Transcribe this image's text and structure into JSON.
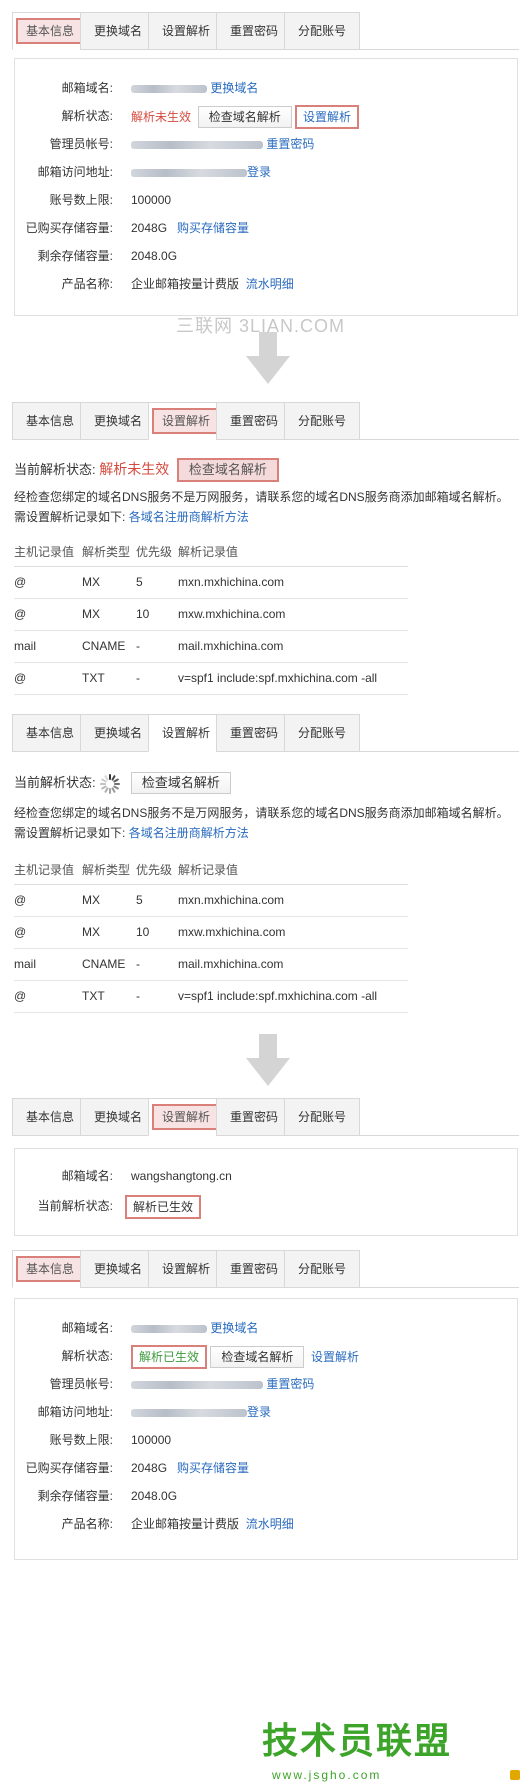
{
  "tabs": [
    "基本信息",
    "更换域名",
    "设置解析",
    "重置密码",
    "分配账号"
  ],
  "panel1": {
    "rows": [
      {
        "label": "邮箱域名:",
        "link": "更换域名"
      },
      {
        "label": "解析状态:",
        "status": "解析未生效",
        "button": "检查域名解析",
        "link": "设置解析"
      },
      {
        "label": "管理员帐号:",
        "link": "重置密码"
      },
      {
        "label": "邮箱访问地址:",
        "link": "登录"
      },
      {
        "label": "账号数上限:",
        "value": "100000"
      },
      {
        "label": "已购买存储容量:",
        "value": "2048G",
        "link": "购买存储容量"
      },
      {
        "label": "剩余存储容量:",
        "value": "2048.0G"
      },
      {
        "label": "产品名称:",
        "value": "企业邮箱按量计费版",
        "link": "流水明细"
      }
    ]
  },
  "watermark": "三联网 3LIAN.COM",
  "dns_section": {
    "status_label": "当前解析状态:",
    "status_value": "解析未生效",
    "check_button": "检查域名解析",
    "notice": "经检查您绑定的域名DNS服务不是万网服务，请联系您的域名DNS服务商添加邮箱域名解析。",
    "need_text": "需设置解析记录如下:",
    "method_link": "各域名注册商解析方法",
    "headers": [
      "主机记录值",
      "解析类型",
      "优先级",
      "解析记录值"
    ],
    "records": [
      [
        "@",
        "MX",
        "5",
        "mxn.mxhichina.com"
      ],
      [
        "@",
        "MX",
        "10",
        "mxw.mxhichina.com"
      ],
      [
        "mail",
        "CNAME",
        "-",
        "mail.mxhichina.com"
      ],
      [
        "@",
        "TXT",
        "-",
        "v=spf1 include:spf.mxhichina.com -all"
      ]
    ]
  },
  "panel4": {
    "domain_label": "邮箱域名:",
    "domain_value": "wangshangtong.cn",
    "status_label": "当前解析状态:",
    "status_value": "解析已生效"
  },
  "panel5": {
    "rows": [
      {
        "label": "邮箱域名:",
        "link": "更换域名"
      },
      {
        "label": "解析状态:",
        "status": "解析已生效",
        "button": "检查域名解析",
        "link": "设置解析"
      },
      {
        "label": "管理员帐号:",
        "link": "重置密码"
      },
      {
        "label": "邮箱访问地址:",
        "link": "登录"
      },
      {
        "label": "账号数上限:",
        "value": "100000"
      },
      {
        "label": "已购买存储容量:",
        "value": "2048G",
        "link": "购买存储容量"
      },
      {
        "label": "剩余存储容量:",
        "value": "2048.0G"
      },
      {
        "label": "产品名称:",
        "value": "企业邮箱按量计费版",
        "link": "流水明细"
      }
    ]
  },
  "logo": {
    "title": "技术员联盟",
    "subtitle": "www.jsgho.com"
  },
  "colors": {
    "accent_link": "#2a6bbf",
    "status_red": "#d54b3f",
    "status_green": "#3d9a3d",
    "highlight_border": "#d9807a"
  }
}
